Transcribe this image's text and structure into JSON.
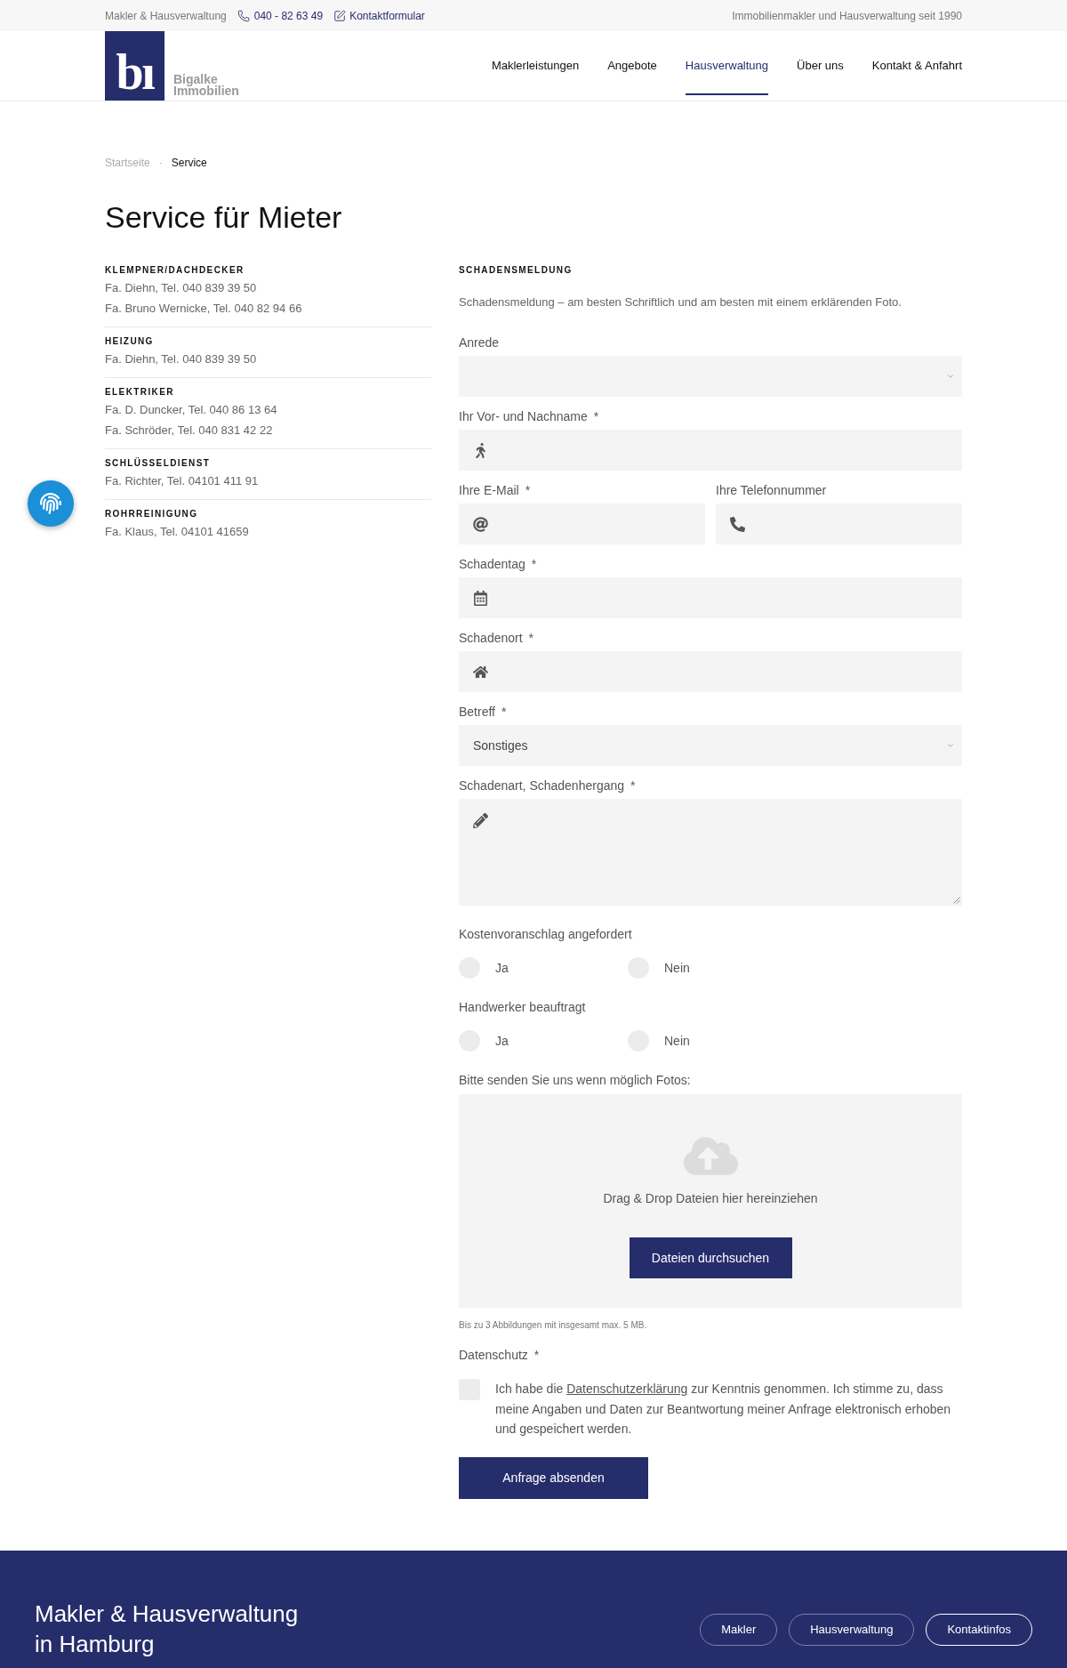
{
  "top_bar": {
    "label": "Makler & Hausverwaltung",
    "phone": "040 - 82 63 49",
    "contact_link": "Kontaktformular",
    "tagline": "Immobilienmakler und Hausverwaltung seit 1990"
  },
  "header": {
    "logo": {
      "mark": "bı",
      "name_lines": [
        "Bigalke",
        "Immobilien"
      ]
    },
    "nav": [
      {
        "label": "Maklerleistungen",
        "selected": false
      },
      {
        "label": "Angebote",
        "selected": false
      },
      {
        "label": "Hausverwaltung",
        "selected": true
      },
      {
        "label": "Über uns",
        "selected": false
      },
      {
        "label": "Kontakt & Anfahrt",
        "selected": false
      }
    ]
  },
  "breadcrumb": {
    "separator": "·",
    "items": [
      {
        "label": "Startseite",
        "current": false
      },
      {
        "label": "Service",
        "current": true
      }
    ]
  },
  "page_title": "Service für Mieter",
  "contacts": [
    {
      "heading": "KLEMPNER/DACHDECKER",
      "lines": [
        "Fa. Diehn, Tel. 040 839 39 50",
        "Fa. Bruno Wernicke, Tel. 040 82 94 66"
      ]
    },
    {
      "heading": "HEIZUNG",
      "lines": [
        "Fa. Diehn, Tel. 040 839 39 50"
      ]
    },
    {
      "heading": "ELEKTRIKER",
      "lines": [
        "Fa. D. Duncker, Tel. 040 86 13 64",
        "Fa. Schröder, Tel. 040 831 42 22"
      ]
    },
    {
      "heading": "SCHLÜSSELDIENST",
      "lines": [
        "Fa. Richter, Tel. 04101 411 91"
      ]
    },
    {
      "heading": "ROHRREINIGUNG",
      "lines": [
        "Fa. Klaus, Tel. 04101 41659"
      ]
    }
  ],
  "form": {
    "heading": "SCHADENSMELDUNG",
    "intro": "Schadensmeldung – am besten Schriftlich und am besten mit einem erklärenden Foto.",
    "fields": [
      {
        "kind": "select",
        "label": "Anrede"
      },
      {
        "kind": "name",
        "label": "Ihr Vor- und Nachname",
        "required_mark": "*"
      },
      {
        "kind": "row",
        "fields": [
          {
            "kind": "email",
            "label": "Ihre E-Mail",
            "required_mark": "*"
          },
          {
            "kind": "phone",
            "label": "Ihre Telefonnummer"
          }
        ]
      },
      {
        "kind": "date",
        "label": "Schadentag",
        "required_mark": "*"
      },
      {
        "kind": "place",
        "label": "Schadenort",
        "required_mark": "*"
      },
      {
        "kind": "select",
        "label": "Betreff",
        "required_mark": "*",
        "value": "Sonstiges"
      },
      {
        "kind": "textarea",
        "label": "Schadenart, Schadenhergang",
        "required_mark": "*"
      },
      {
        "kind": "radio",
        "label": "Kostenvoranschlag angefordert",
        "options": [
          {
            "label": "Ja",
            "selected": false
          },
          {
            "label": "Nein",
            "selected": false
          }
        ]
      },
      {
        "kind": "radio",
        "label": "Handwerker beauftragt",
        "options": [
          {
            "label": "Ja",
            "selected": false
          },
          {
            "label": "Nein",
            "selected": false
          }
        ]
      },
      {
        "kind": "upload",
        "label": "Bitte senden Sie uns wenn möglich Fotos:",
        "drop_text": "Drag & Drop Dateien hier hereinziehen",
        "button": "Dateien durchsuchen",
        "note": "Bis zu 3 Abbildungen mit insgesamt max. 5 MB."
      },
      {
        "kind": "consent",
        "label": "Datenschutz",
        "required_mark": "*",
        "checked": false,
        "text_before": "Ich habe die ",
        "link": "Datenschutzerklärung",
        "text_after": " zur Kenntnis genommen. Ich stimme zu, dass meine Angaben und Daten zur Beantwortung meiner Anfrage elektronisch erhoben und gespeichert werden."
      }
    ],
    "submit": "Anfrage absenden"
  },
  "footer": {
    "title_lines": [
      "Makler & Hausverwaltung",
      "in Hamburg"
    ],
    "buttons": [
      {
        "label": "Makler",
        "primary": false
      },
      {
        "label": "Hausverwaltung",
        "primary": false
      },
      {
        "label": "Kontaktinfos",
        "primary": true
      }
    ]
  }
}
